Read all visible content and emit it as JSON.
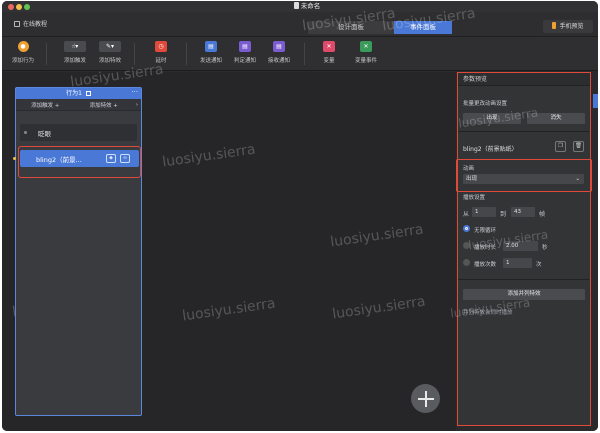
{
  "window": {
    "title": "未命名"
  },
  "header": {
    "tutorial": "在线教程",
    "tabs": [
      {
        "label": "设计面板",
        "active": false
      },
      {
        "label": "事件面板",
        "active": true
      }
    ],
    "preview": "手机预览"
  },
  "toolbar": {
    "items": [
      {
        "label": "添加行为",
        "icon": "behavior-icon",
        "color": "#f0a030"
      },
      {
        "label": "添加触发",
        "icon": "touch-icon",
        "color": "#4a4b4f"
      },
      {
        "label": "添加特效",
        "icon": "magic-wand-icon",
        "color": "#4a4b4f"
      },
      {
        "label": "延时",
        "icon": "timer-icon",
        "color": "#e04a3a"
      },
      {
        "label": "发送通知",
        "icon": "send-icon",
        "color": "#4a78d6"
      },
      {
        "label": "判定通知",
        "icon": "judge-icon",
        "color": "#7a5bd0"
      },
      {
        "label": "接收通知",
        "icon": "receive-icon",
        "color": "#7a5bd0"
      },
      {
        "label": "变量",
        "icon": "variable-icon",
        "color": "#e04a6a"
      },
      {
        "label": "变量事件",
        "icon": "variable-event-icon",
        "color": "#3a9a5a"
      }
    ]
  },
  "behavior": {
    "title": "行为1",
    "add_trigger": "添加触发 +",
    "add_effect": "添加特效 +",
    "items": [
      {
        "label": "眨眼",
        "selected": false
      },
      {
        "label": "bling2（前景...",
        "selected": true
      }
    ]
  },
  "watermark": "luosiyu.sierra",
  "panel": {
    "title": "参数预览",
    "batch_label": "批量更改动画设置",
    "appear": "出现",
    "disappear": "消失",
    "effect_name": "bling2（前景贴纸）",
    "anim_label": "动画",
    "anim_value": "出现",
    "play_settings": "播放设置",
    "from_label": "从",
    "from_value": "1",
    "to_label": "到",
    "to_value": "43",
    "frame_unit": "帧",
    "loop_forever": "无限循环",
    "play_duration": "播放时长",
    "duration_value": "2.00",
    "second_unit": "秒",
    "play_count": "播放次数",
    "count_value": "1",
    "count_unit": "次",
    "add_parallel": "添加并列特效",
    "parallel_hint": "并列特效会同时播放"
  }
}
